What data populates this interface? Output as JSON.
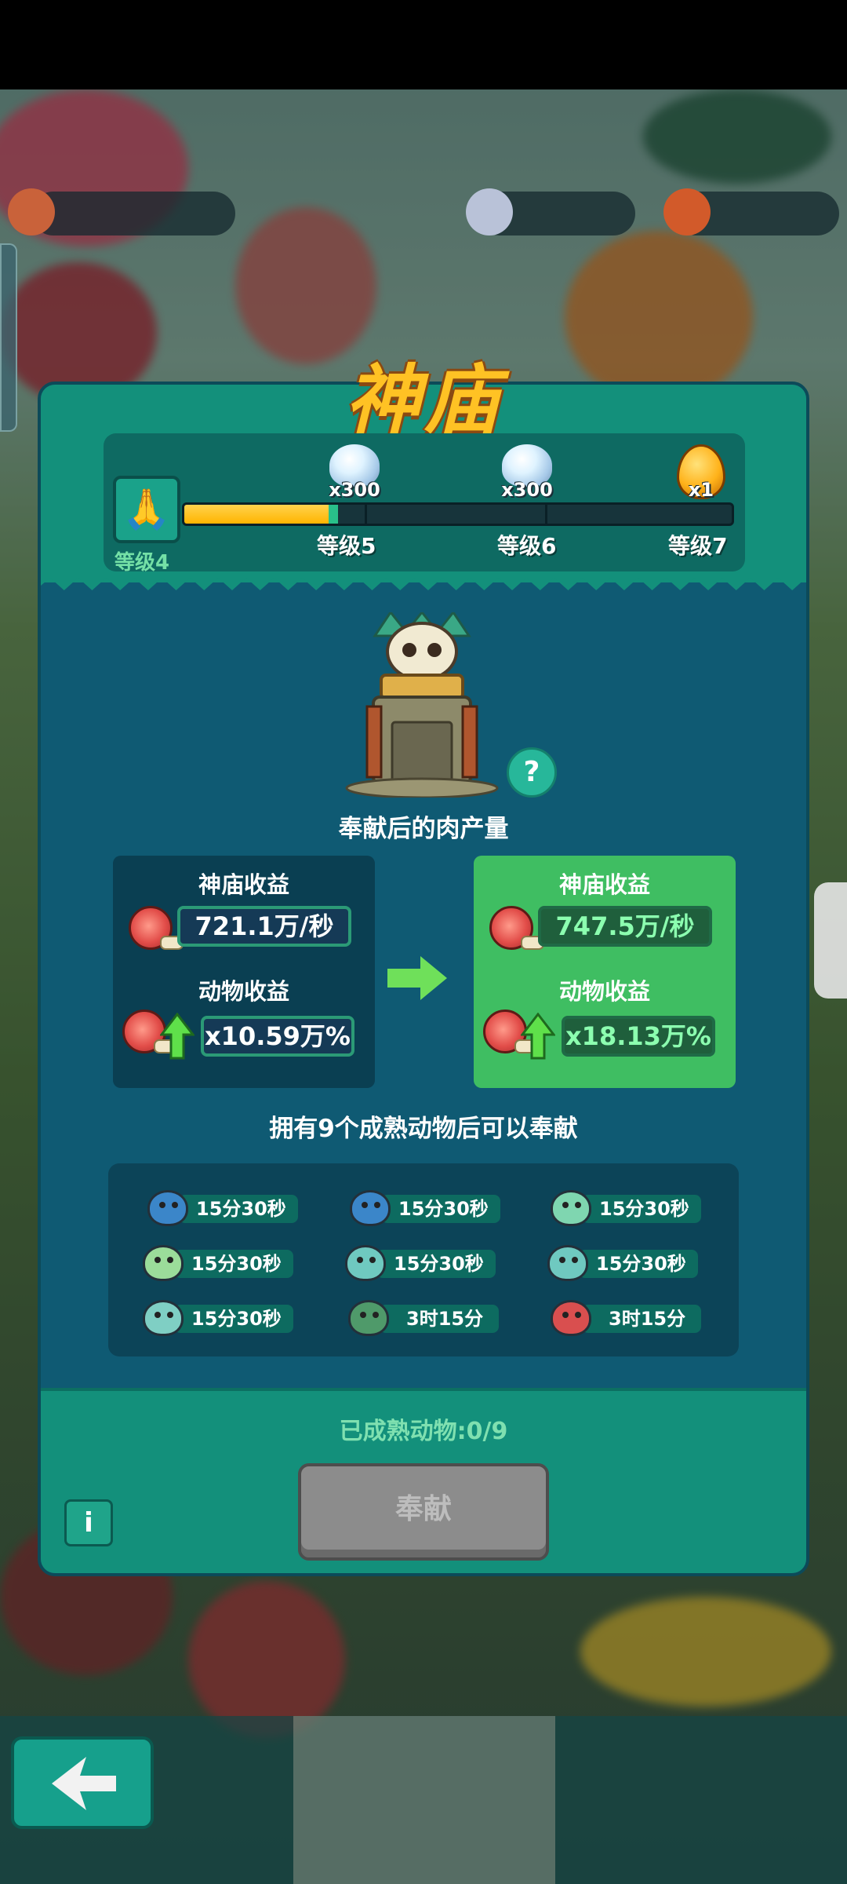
{
  "title": "神庙",
  "levels": {
    "current": "等级4",
    "progress_fraction": 0.27,
    "milestones": [
      {
        "label": "等级5",
        "reward_count": "x300",
        "reward_icon": "pearl-shell-icon"
      },
      {
        "label": "等级6",
        "reward_count": "x300",
        "reward_icon": "pearl-shell-icon"
      },
      {
        "label": "等级7",
        "reward_count": "x1",
        "reward_icon": "golden-egg-icon"
      }
    ]
  },
  "production_title": "奉献后的肉产量",
  "before": {
    "temple_label": "神庙收益",
    "temple_value": "721.1万/秒",
    "animal_label": "动物收益",
    "animal_value": "x10.59万%"
  },
  "after": {
    "temple_label": "神庙收益",
    "temple_value": "747.5万/秒",
    "animal_label": "动物收益",
    "animal_value": "x18.13万%"
  },
  "condition_text": "拥有9个成熟动物后可以奉献",
  "animals": [
    {
      "timer": "15分30秒",
      "color": "#3b86c9"
    },
    {
      "timer": "15分30秒",
      "color": "#3b86c9"
    },
    {
      "timer": "15分30秒",
      "color": "#7fd6b0"
    },
    {
      "timer": "15分30秒",
      "color": "#9bdc9a"
    },
    {
      "timer": "15分30秒",
      "color": "#6fc9c0"
    },
    {
      "timer": "15分30秒",
      "color": "#6fc9c0"
    },
    {
      "timer": "15分30秒",
      "color": "#7fcfc4"
    },
    {
      "timer": "3时15分",
      "color": "#4f9a6a"
    },
    {
      "timer": "3时15分",
      "color": "#d94f4f"
    }
  ],
  "matured_text": "已成熟动物:0/9",
  "offer_button": "奉献",
  "info_button": "i",
  "help_button": "?",
  "colors": {
    "panel": "#0f5a73",
    "panel_header": "#13907b",
    "after_box": "#3fbe62",
    "title": "#ffc224",
    "progress": "#ffb400"
  }
}
